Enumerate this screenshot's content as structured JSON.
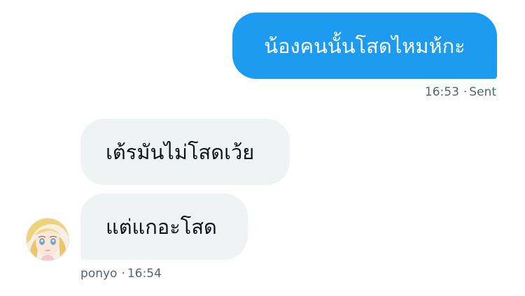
{
  "conversation": {
    "sent_message": {
      "text": "น้องคนนั้นโสดไหมห้กะ",
      "time": "16:53",
      "status": "Sent"
    },
    "received_messages": [
      {
        "text": "เต้รมันไม่โสดเว้ย"
      },
      {
        "text": "แต่แกอะโสด"
      }
    ],
    "received_meta": {
      "sender": "ponyo",
      "time": "16:54"
    }
  },
  "colors": {
    "sent_bubble": "#1d9bf0",
    "received_bubble": "#eff3f4",
    "meta_text": "#536471"
  },
  "icons": {
    "avatar": "anime-girl-avatar"
  }
}
